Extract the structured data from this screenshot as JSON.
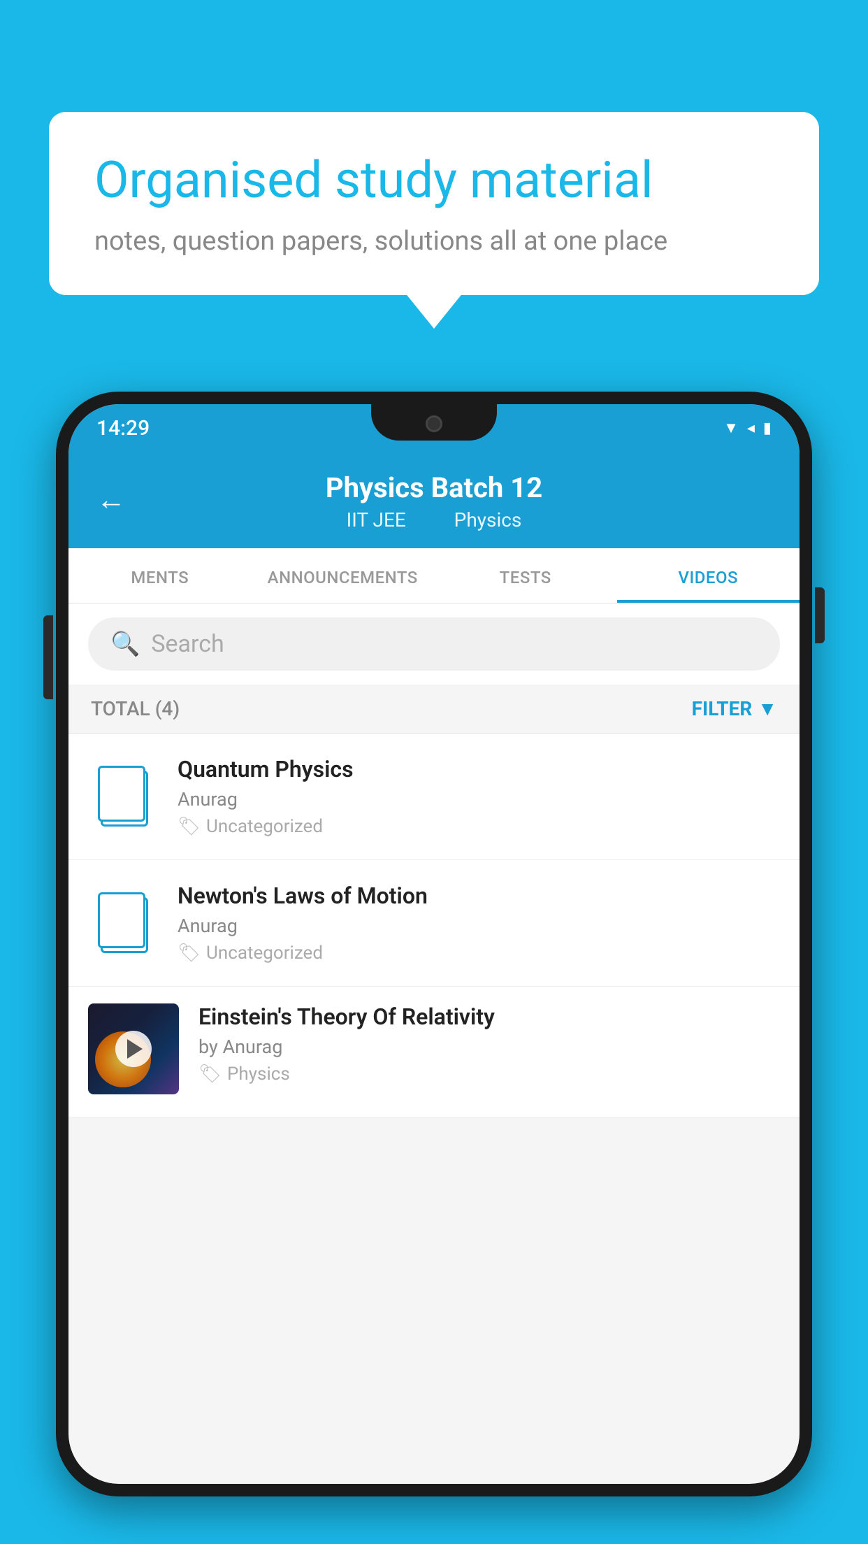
{
  "background": {
    "color": "#1ab8e8"
  },
  "speech_bubble": {
    "title": "Organised study material",
    "subtitle": "notes, question papers, solutions all at one place"
  },
  "phone": {
    "status_bar": {
      "time": "14:29",
      "icons": "▼ ◀ ▮"
    },
    "header": {
      "back_label": "←",
      "title": "Physics Batch 12",
      "subtitle_part1": "IIT JEE",
      "subtitle_part2": "Physics"
    },
    "tabs": [
      {
        "label": "MENTS",
        "active": false
      },
      {
        "label": "ANNOUNCEMENTS",
        "active": false
      },
      {
        "label": "TESTS",
        "active": false
      },
      {
        "label": "VIDEOS",
        "active": true
      }
    ],
    "search": {
      "placeholder": "Search"
    },
    "filter": {
      "total_label": "TOTAL (4)",
      "filter_label": "FILTER"
    },
    "videos": [
      {
        "id": 1,
        "title": "Quantum Physics",
        "author": "Anurag",
        "tag": "Uncategorized",
        "has_thumbnail": false
      },
      {
        "id": 2,
        "title": "Newton's Laws of Motion",
        "author": "Anurag",
        "tag": "Uncategorized",
        "has_thumbnail": false
      },
      {
        "id": 3,
        "title": "Einstein's Theory Of Relativity",
        "author": "by Anurag",
        "tag": "Physics",
        "has_thumbnail": true
      }
    ]
  }
}
